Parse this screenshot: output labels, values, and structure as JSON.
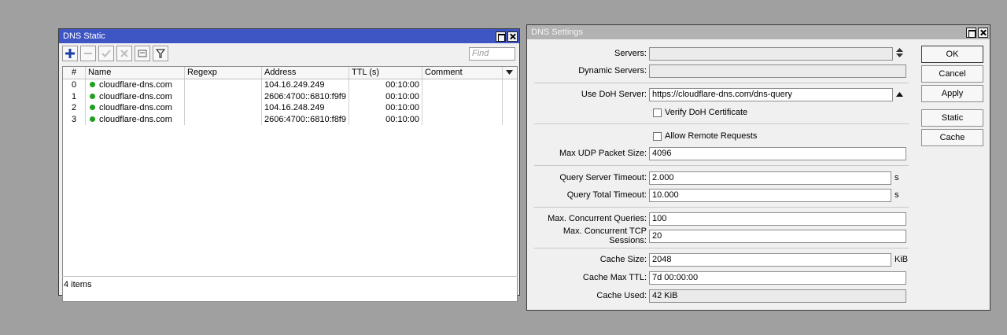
{
  "dns_static": {
    "title": "DNS Static",
    "find_placeholder": "Find",
    "columns": [
      "#",
      "Name",
      "Regexp",
      "Address",
      "TTL (s)",
      "Comment"
    ],
    "rows": [
      {
        "num": "0",
        "name": "cloudflare-dns.com",
        "regexp": "",
        "address": "104.16.249.249",
        "ttl": "00:10:00",
        "comment": ""
      },
      {
        "num": "1",
        "name": "cloudflare-dns.com",
        "regexp": "",
        "address": "2606:4700::6810:f9f9",
        "ttl": "00:10:00",
        "comment": ""
      },
      {
        "num": "2",
        "name": "cloudflare-dns.com",
        "regexp": "",
        "address": "104.16.248.249",
        "ttl": "00:10:00",
        "comment": ""
      },
      {
        "num": "3",
        "name": "cloudflare-dns.com",
        "regexp": "",
        "address": "2606:4700::6810:f8f9",
        "ttl": "00:10:00",
        "comment": ""
      }
    ],
    "status": "4 items"
  },
  "dns_settings": {
    "title": "DNS Settings",
    "servers_label": "Servers:",
    "servers_value": "",
    "dynamic_servers_label": "Dynamic Servers:",
    "dynamic_servers_value": "",
    "doh_label": "Use DoH Server:",
    "doh_value": "https://cloudflare-dns.com/dns-query",
    "verify_doh_label": "Verify DoH Certificate",
    "allow_remote_label": "Allow Remote Requests",
    "max_udp_label": "Max UDP Packet Size:",
    "max_udp_value": "4096",
    "query_server_timeout_label": "Query Server Timeout:",
    "query_server_timeout_value": "2.000",
    "query_server_timeout_unit": "s",
    "query_total_timeout_label": "Query Total Timeout:",
    "query_total_timeout_value": "10.000",
    "query_total_timeout_unit": "s",
    "max_concurrent_queries_label": "Max. Concurrent Queries:",
    "max_concurrent_queries_value": "100",
    "max_tcp_sessions_label": "Max. Concurrent TCP Sessions:",
    "max_tcp_sessions_value": "20",
    "cache_size_label": "Cache Size:",
    "cache_size_value": "2048",
    "cache_size_unit": "KiB",
    "cache_max_ttl_label": "Cache Max TTL:",
    "cache_max_ttl_value": "7d 00:00:00",
    "cache_used_label": "Cache Used:",
    "cache_used_value": "42 KiB",
    "buttons": {
      "ok": "OK",
      "cancel": "Cancel",
      "apply": "Apply",
      "static": "Static",
      "cache": "Cache"
    }
  }
}
